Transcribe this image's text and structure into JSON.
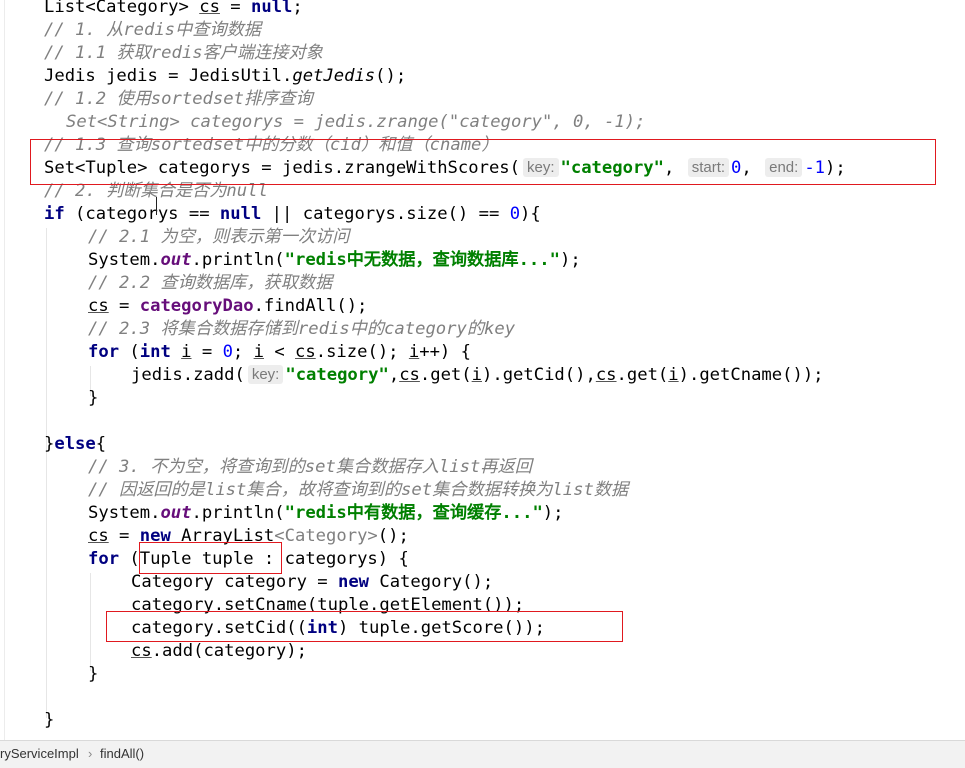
{
  "code": {
    "l1_type": "List<Category>",
    "l1_var": "cs",
    "l1_eq": " = ",
    "l1_null": "null",
    "l1_end": ";",
    "c1": "// 1. 从redis中查询数据",
    "c1_1": "// 1.1 获取redis客户端连接对象",
    "l4_a": "Jedis jedis = JedisUtil.",
    "l4_m": "getJedis",
    "l4_b": "();",
    "c1_2": "// 1.2 使用sortedset排序查询",
    "l6": "Set<String> categorys = jedis.zrange(\"category\", 0, -1);",
    "c1_3": "// 1.3 查询sortedset中的分数（cid）和值（cname）",
    "l8_a": "Set<Tuple> categorys = jedis.zrangeWithScores(",
    "hint_key": "key:",
    "str_category": "\"category\"",
    "comma": ", ",
    "hint_start": "start:",
    "n0": "0",
    "hint_end": "end:",
    "nm1": "-1",
    "l8_end": ");",
    "c2": "// 2. 判断集合是否为null",
    "l10_if": "if",
    "l10_a": " (categorys == ",
    "l10_null": "null",
    "l10_b": " || categorys.size() == ",
    "l10_c": "){",
    "c2_1": "// 2.1 为空，则表示第一次访问",
    "sys": "System.",
    "out": "out",
    "println": ".println(",
    "s_nodata": "\"redis中无数据，查询数据库...\"",
    "close_paren_semi": ");",
    "c2_2": "// 2.2 查询数据库，获取数据",
    "l14_cs": "cs",
    "l14_eq": " = ",
    "l14_dao": "categoryDao",
    "l14_rest": ".findAll();",
    "c2_3": "// 2.3 将集合数据存储到redis中的category的key",
    "for": "for",
    "l16_a": " (",
    "int": "int",
    "i": "i",
    "l16_b": " = ",
    "l16_c": "; ",
    "l16_d": " < ",
    "l16_e": ".size(); ",
    "l16_f": "++) {",
    "l17_a": "jedis.zadd(",
    "l17_b": ",",
    "l17_c": ".get(",
    "l17_d": ").getCid(),",
    "l17_e": ").getCname());",
    "brace": "}",
    "else_a": "}",
    "else": "else",
    "else_b": "{",
    "c3": "// 3. 不为空，将查询到的set集合数据存入list再返回",
    "c3b": "// 因返回的是list集合，故将查询到的set集合数据转换为list数据",
    "s_hasdata": "\"redis中有数据，查询缓存...\"",
    "new": "new",
    "l24_b": " ArrayList",
    "l24_gen": "<Category>",
    "l24_c": "();",
    "l25_b": " (",
    "l25_tuple": "Tuple tuple :",
    "l25_c": " categorys) {",
    "l26_a": "Category category = ",
    "l26_b": " Category();",
    "l27": "category.setCname(tuple.getElement());",
    "l28_a": "category.setCid((",
    "l28_b": ") tuple.getScore());",
    "l29_b": ".add(category);"
  },
  "breadcrumb": {
    "class_name": "ryServiceImpl",
    "separator": "›",
    "method": "findAll()"
  },
  "colors": {
    "keyword": "#000080",
    "comment": "#808080",
    "string": "#008000",
    "number": "#0000ff",
    "field": "#660e7a",
    "highlight_box": "#e0191f"
  }
}
